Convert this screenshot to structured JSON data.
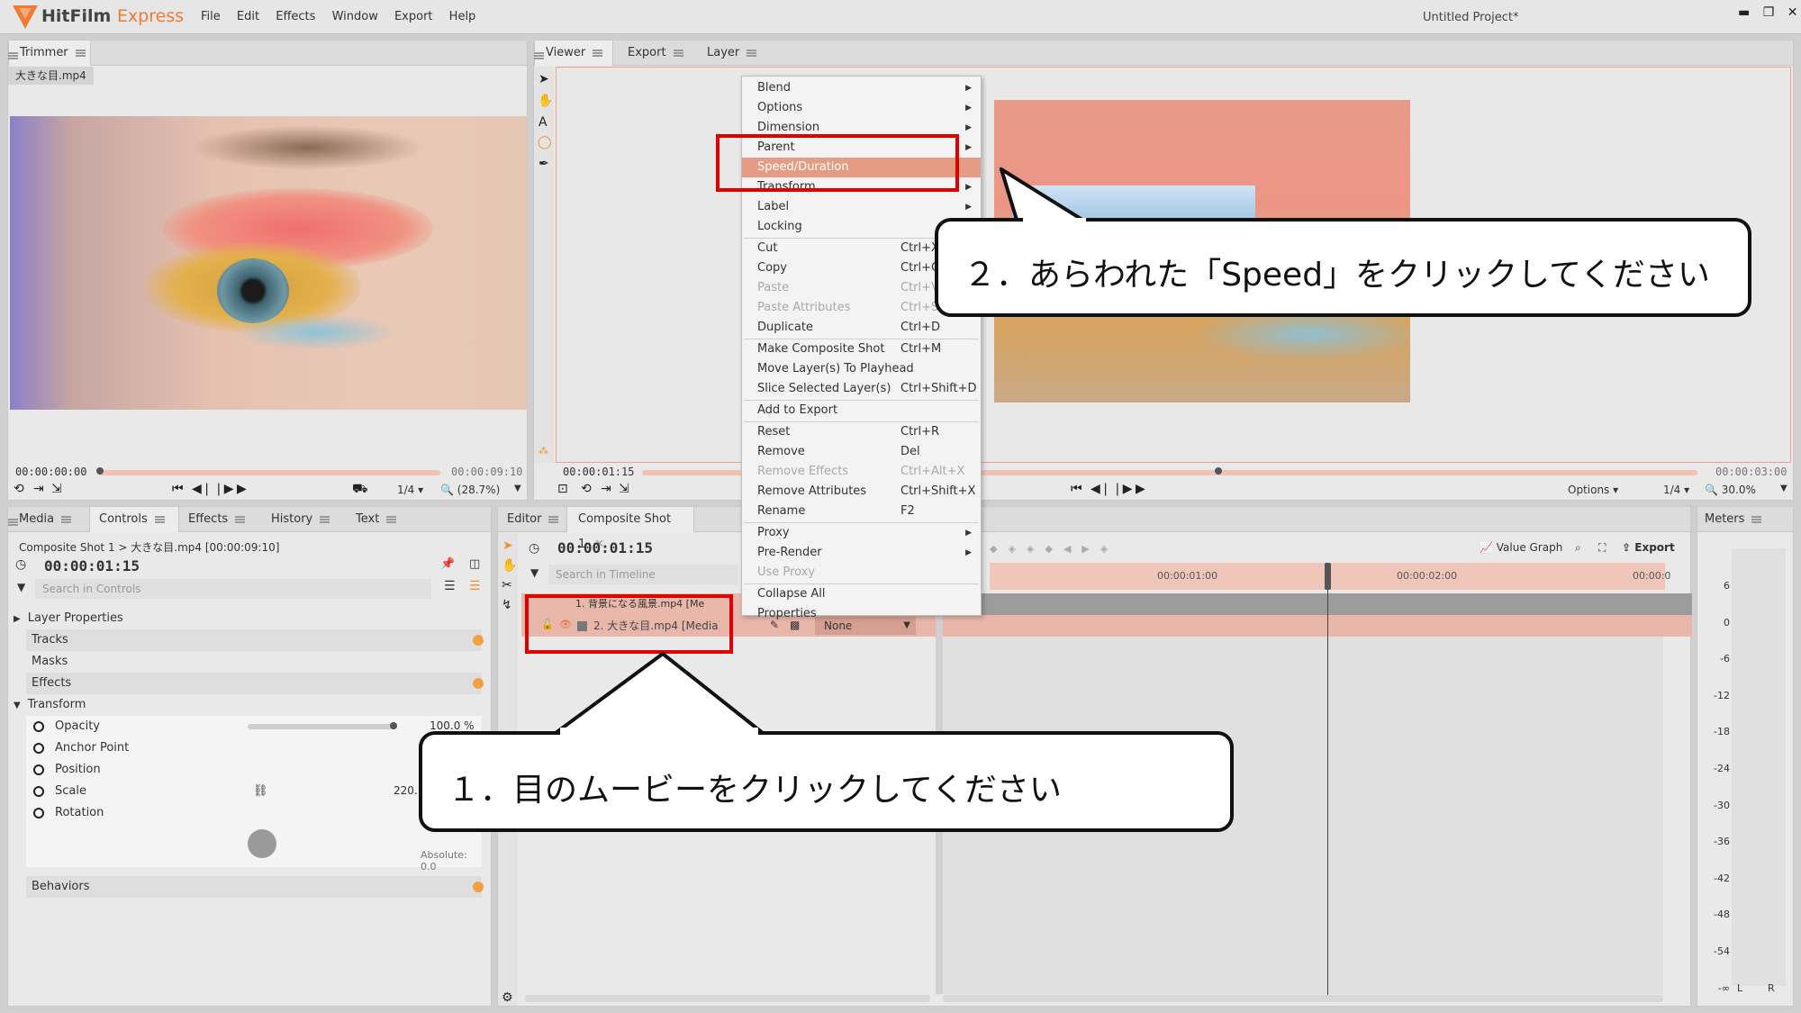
{
  "app": {
    "logo_name": "HitFilm",
    "logo_suffix": "Express",
    "project_title": "Untitled Project*",
    "menu": [
      "File",
      "Edit",
      "Effects",
      "Window",
      "Export",
      "Help"
    ]
  },
  "trimmer": {
    "tab": "Trimmer",
    "file": "大きな目.mp4",
    "time_start": "00:00:00:00",
    "time_end": "00:00:09:10",
    "quality": "1/4",
    "zoom": "(28.7%)"
  },
  "viewer": {
    "tabs": [
      "Viewer",
      "Export",
      "Layer"
    ],
    "time_current": "00:00:01:15",
    "time_end": "00:00:03:00",
    "options": "Options",
    "quality": "1/4",
    "zoom": "30.0%"
  },
  "context_menu": {
    "items": [
      {
        "label": "Blend",
        "shortcut": "",
        "submenu": true,
        "disabled": false
      },
      {
        "label": "Options",
        "shortcut": "",
        "submenu": true,
        "disabled": false
      },
      {
        "label": "Dimension",
        "shortcut": "",
        "submenu": true,
        "disabled": false
      },
      {
        "label": "Parent",
        "shortcut": "",
        "submenu": true,
        "disabled": false
      },
      {
        "label": "Speed/Duration",
        "shortcut": "",
        "submenu": false,
        "disabled": false,
        "highlighted": true
      },
      {
        "label": "Transform",
        "shortcut": "",
        "submenu": true,
        "disabled": false
      },
      {
        "label": "Label",
        "shortcut": "",
        "submenu": true,
        "disabled": false
      },
      {
        "label": "Locking",
        "shortcut": "",
        "submenu": false,
        "disabled": false
      },
      {
        "label": "Cut",
        "shortcut": "Ctrl+X",
        "submenu": false,
        "disabled": false
      },
      {
        "label": "Copy",
        "shortcut": "Ctrl+C",
        "submenu": false,
        "disabled": false
      },
      {
        "label": "Paste",
        "shortcut": "Ctrl+V",
        "submenu": false,
        "disabled": true
      },
      {
        "label": "Paste Attributes",
        "shortcut": "Ctrl+S",
        "submenu": false,
        "disabled": true
      },
      {
        "label": "Duplicate",
        "shortcut": "Ctrl+D",
        "submenu": false,
        "disabled": false
      },
      {
        "label": "Make Composite Shot",
        "shortcut": "Ctrl+M",
        "submenu": false,
        "disabled": false
      },
      {
        "label": "Move Layer(s) To Playhead",
        "shortcut": "",
        "submenu": false,
        "disabled": false
      },
      {
        "label": "Slice Selected Layer(s)",
        "shortcut": "Ctrl+Shift+D",
        "submenu": false,
        "disabled": false
      },
      {
        "label": "Add to Export",
        "shortcut": "",
        "submenu": false,
        "disabled": false
      },
      {
        "label": "Reset",
        "shortcut": "Ctrl+R",
        "submenu": false,
        "disabled": false
      },
      {
        "label": "Remove",
        "shortcut": "Del",
        "submenu": false,
        "disabled": false
      },
      {
        "label": "Remove Effects",
        "shortcut": "Ctrl+Alt+X",
        "submenu": false,
        "disabled": true
      },
      {
        "label": "Remove Attributes",
        "shortcut": "Ctrl+Shift+X",
        "submenu": false,
        "disabled": false
      },
      {
        "label": "Rename",
        "shortcut": "F2",
        "submenu": false,
        "disabled": false
      },
      {
        "label": "Proxy",
        "shortcut": "",
        "submenu": true,
        "disabled": false
      },
      {
        "label": "Pre-Render",
        "shortcut": "",
        "submenu": true,
        "disabled": false
      },
      {
        "label": "Use Proxy",
        "shortcut": "",
        "submenu": false,
        "disabled": true
      },
      {
        "label": "Collapse All",
        "shortcut": "",
        "submenu": false,
        "disabled": false
      },
      {
        "label": "Properties",
        "shortcut": "",
        "submenu": false,
        "disabled": false
      }
    ]
  },
  "controls": {
    "tabs": [
      "Media",
      "Controls",
      "Effects",
      "History",
      "Text"
    ],
    "breadcrumb": "Composite Shot 1 > 大きな目.mp4 [00:00:09:10]",
    "time": "00:00:01:15",
    "search_placeholder": "Search in Controls",
    "sections": [
      "Layer Properties",
      "Tracks",
      "Masks",
      "Effects",
      "Transform"
    ],
    "properties": [
      {
        "name": "Opacity",
        "value": "100.0 %"
      },
      {
        "name": "Anchor Point",
        "value": ""
      },
      {
        "name": "Position",
        "value": ""
      },
      {
        "name": "Scale",
        "value": "220."
      },
      {
        "name": "Rotation",
        "value": "Absolute: 0.0"
      }
    ],
    "behaviors": "Behaviors"
  },
  "editor": {
    "tabs": [
      "Editor",
      "Composite Shot 1"
    ],
    "time": "00:00:01:15",
    "search_placeholder": "Search in Timeline",
    "layers": [
      {
        "name": "1. 背景になる風景.mp4 [Me"
      },
      {
        "name": "2. 大きな目.mp4 [Media]"
      }
    ],
    "blend_value": "None",
    "value_graph": "Value Graph",
    "export": "Export",
    "ruler": [
      "00:00:01:00",
      "00:00:02:00",
      "00:00:0"
    ]
  },
  "meters": {
    "tab": "Meters",
    "scale": [
      "6",
      "0",
      "-6",
      "-12",
      "-18",
      "-24",
      "-30",
      "-36",
      "-42",
      "-48",
      "-54",
      "-∞"
    ],
    "channels": [
      "L",
      "R"
    ]
  },
  "callouts": {
    "step1": "１．目のムービーをクリックしてください",
    "step2": "２．あらわれた「Speed」をクリックしてください"
  },
  "colors": {
    "accent": "#e8876a",
    "highlight": "#e69c84",
    "red_annotation": "#e00000",
    "logo": "#f07b35"
  }
}
